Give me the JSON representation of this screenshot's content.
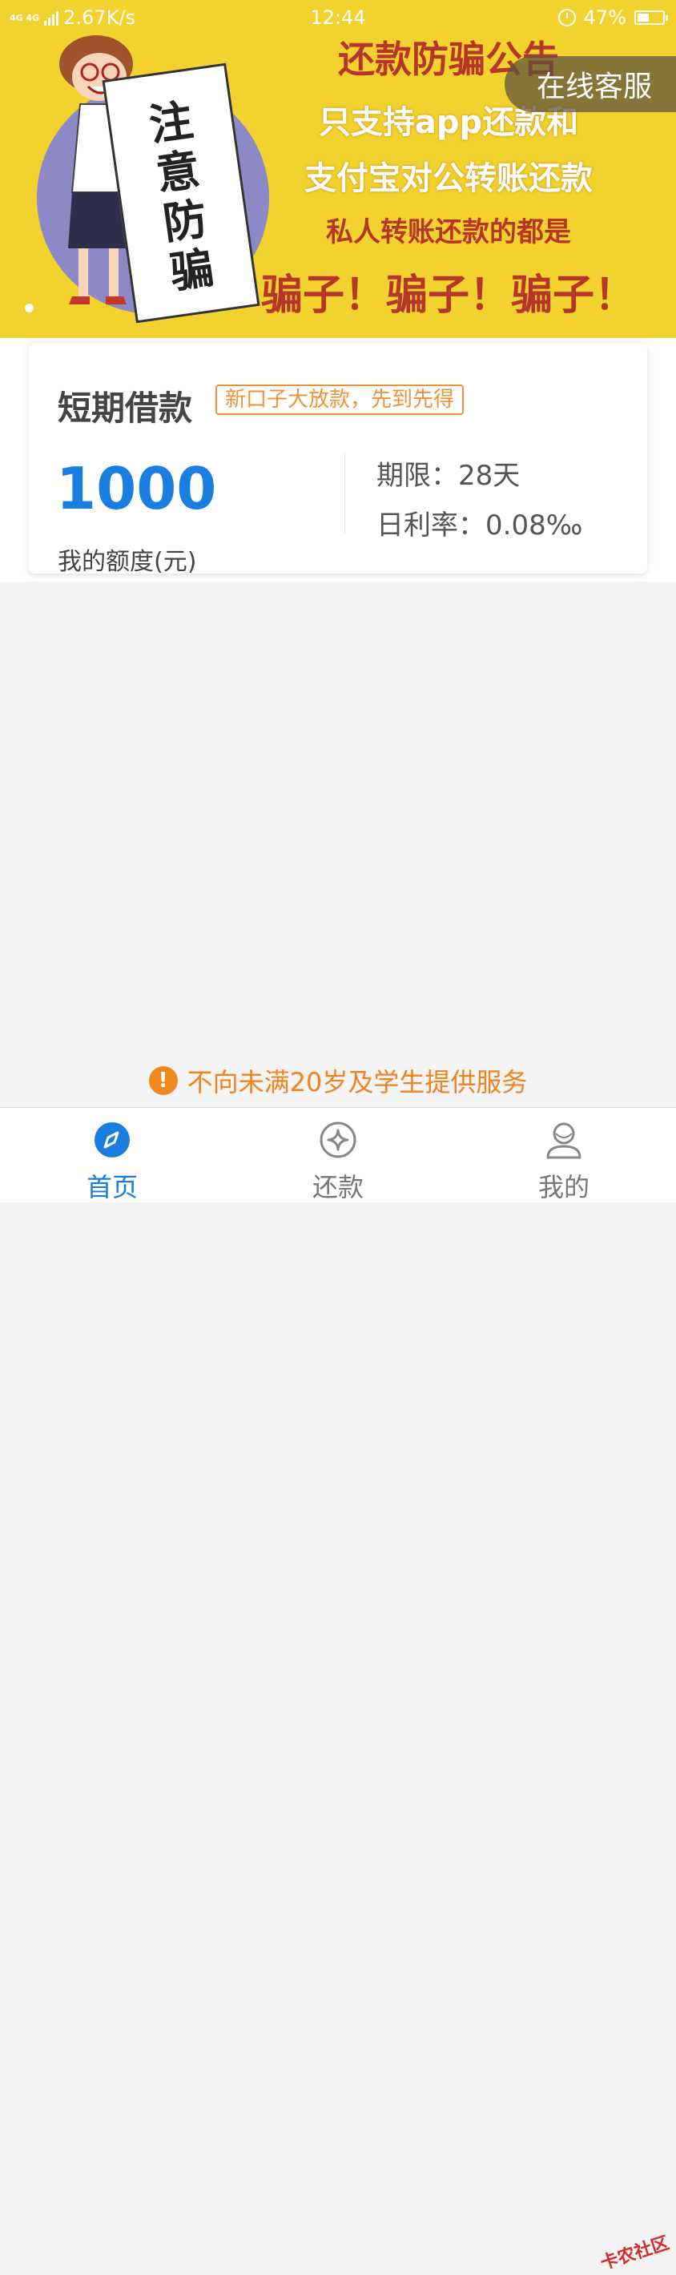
{
  "status_bar": {
    "network": "4G 4G",
    "speed": "2.67K/s",
    "time": "12:44",
    "battery": "47%"
  },
  "banner": {
    "scroll_text": "注意防骗",
    "title": "还款防骗公告",
    "line1": "只支持app还款和",
    "line2": "支付宝对公转账还款",
    "line3": "私人转账还款的都是",
    "line4": "骗子！骗子！骗子！",
    "service_button": "在线客服",
    "colors": {
      "background": "#f2d22e",
      "title": "#b7362a"
    }
  },
  "loan_card": {
    "title": "短期借款",
    "tag": "新口子大放款，先到先得",
    "amount": "1000",
    "amount_label": "我的额度(元)",
    "term": "期限：28天",
    "rate": "日利率：0.08‰"
  },
  "warning": {
    "icon": "exclamation-icon",
    "text": "不向未满20岁及学生提供服务"
  },
  "tabbar": {
    "items": [
      {
        "label": "首页",
        "icon": "compass-icon",
        "active": true
      },
      {
        "label": "还款",
        "icon": "repay-icon",
        "active": false
      },
      {
        "label": "我的",
        "icon": "user-icon",
        "active": false
      }
    ],
    "accent": "#1a7ee0"
  },
  "watermark": "卡农社区"
}
